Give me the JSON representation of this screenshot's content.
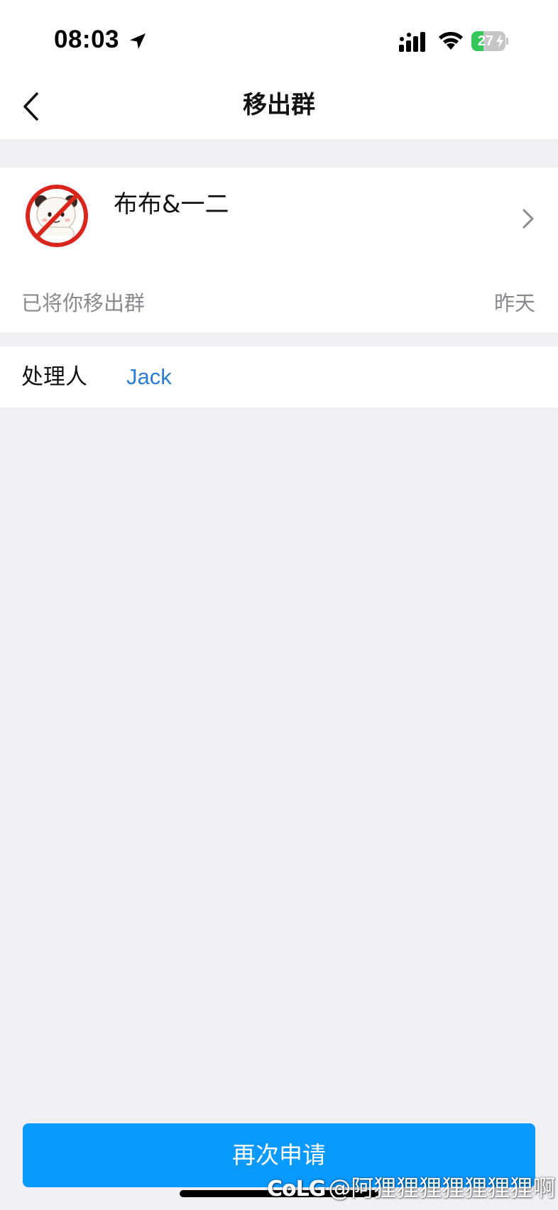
{
  "status_bar": {
    "time": "08:03",
    "battery_level": "27"
  },
  "nav": {
    "title": "移出群"
  },
  "group": {
    "name": "布布&一二",
    "notice": "已将你移出群",
    "time": "昨天",
    "avatar_icon": "panda-prohibited-icon"
  },
  "handler": {
    "label": "处理人",
    "name": "Jack"
  },
  "actions": {
    "reapply_label": "再次申请"
  },
  "watermark": {
    "logo": "CoLG",
    "text": "@阿狸狸狸狸狸狸狸啊"
  },
  "colors": {
    "accent": "#0a99ff",
    "link": "#2b7cd3",
    "background": "#f0f0f5",
    "secondary_text": "#8a8a8e"
  }
}
